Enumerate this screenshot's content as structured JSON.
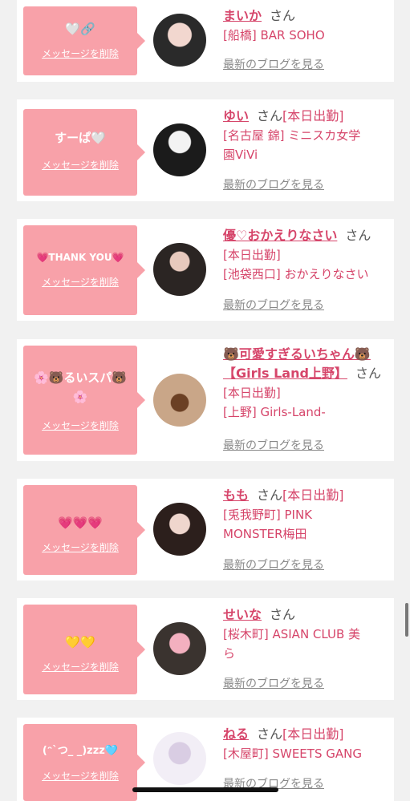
{
  "cards": [
    {
      "message": "🤍🔗",
      "delete_label": "メッセージを削除",
      "name": "まいか",
      "honorific": "さん",
      "status": "",
      "line1": "[船橋] BAR SOHO",
      "line2": "",
      "blog_label": "最新のブログを見る"
    },
    {
      "message": "すーぱ🤍",
      "delete_label": "メッセージを削除",
      "name": "ゆい",
      "honorific": "さん",
      "status": "[本日出勤]",
      "line1": "[名古屋 錦] ミニスカ女学",
      "line2": "園ViVi",
      "blog_label": "最新のブログを見る"
    },
    {
      "message": "💗THANK YOU💗",
      "delete_label": "メッセージを削除",
      "name": "優♡おかえりなさい",
      "honorific": "さん",
      "status": "",
      "line1": "[本日出勤]",
      "line2": "[池袋西口] おかえりなさい",
      "blog_label": "最新のブログを見る"
    },
    {
      "message": "🌸🐻るいスパ🐻",
      "message2": "🌸",
      "delete_label": "メッセージを削除",
      "name": "🐻可愛すぎるいちゃん🐻",
      "name2": "【Girls Land上野】",
      "honorific": "さん",
      "status": "",
      "line1": "[本日出勤]",
      "line2": "[上野] Girls-Land-",
      "blog_label": "最新のブログを見る"
    },
    {
      "message": "💗💗💗",
      "delete_label": "メッセージを削除",
      "name": "もも",
      "honorific": "さん",
      "status": "[本日出勤]",
      "line1": "[兎我野町] PINK",
      "line2": "MONSTER梅田",
      "blog_label": "最新のブログを見る"
    },
    {
      "message": "💛💛",
      "delete_label": "メッセージを削除",
      "name": "せいな",
      "honorific": "さん",
      "status": "",
      "line1": "[桜木町] ASIAN CLUB 美",
      "line2": "ら",
      "blog_label": "最新のブログを見る"
    },
    {
      "message": "(ᵔ`つ_ _)zzz🩵",
      "delete_label": "メッセージを削除",
      "name": "ねる",
      "honorific": "さん",
      "status": "[本日出勤]",
      "line1": "[木屋町] SWEETS GANG",
      "line2": "",
      "blog_label": "最新のブログを見る"
    }
  ],
  "colors": {
    "accent": "#d6456a",
    "bubble": "#f8a1a9",
    "background": "#f1f1f1"
  }
}
